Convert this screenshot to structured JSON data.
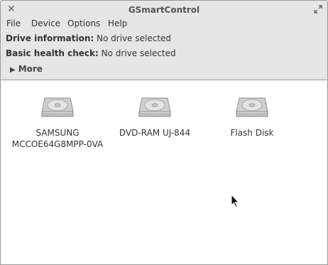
{
  "window": {
    "title": "GSmartControl"
  },
  "menu": [
    {
      "label": "File"
    },
    {
      "label": "Device"
    },
    {
      "label": "Options"
    },
    {
      "label": "Help"
    }
  ],
  "info": {
    "drive_information": {
      "label": "Drive information:",
      "value": "No drive selected"
    },
    "basic_health_check": {
      "label": "Basic health check:",
      "value": "No drive selected"
    },
    "more_label": "More"
  },
  "drives": [
    {
      "name_line1": "SAMSUNG",
      "name_line2": "MCCOE64G8MPP-0VA",
      "icon": "hard-drive-icon"
    },
    {
      "name_line1": "DVD-RAM UJ-844",
      "name_line2": "",
      "icon": "hard-drive-icon"
    },
    {
      "name_line1": "Flash Disk",
      "name_line2": "",
      "icon": "hard-drive-icon"
    }
  ],
  "icons": {
    "close": "close-icon",
    "maximize": "maximize-icon",
    "expander": "triangle-right-icon",
    "pointer": "mouse-pointer-icon"
  }
}
